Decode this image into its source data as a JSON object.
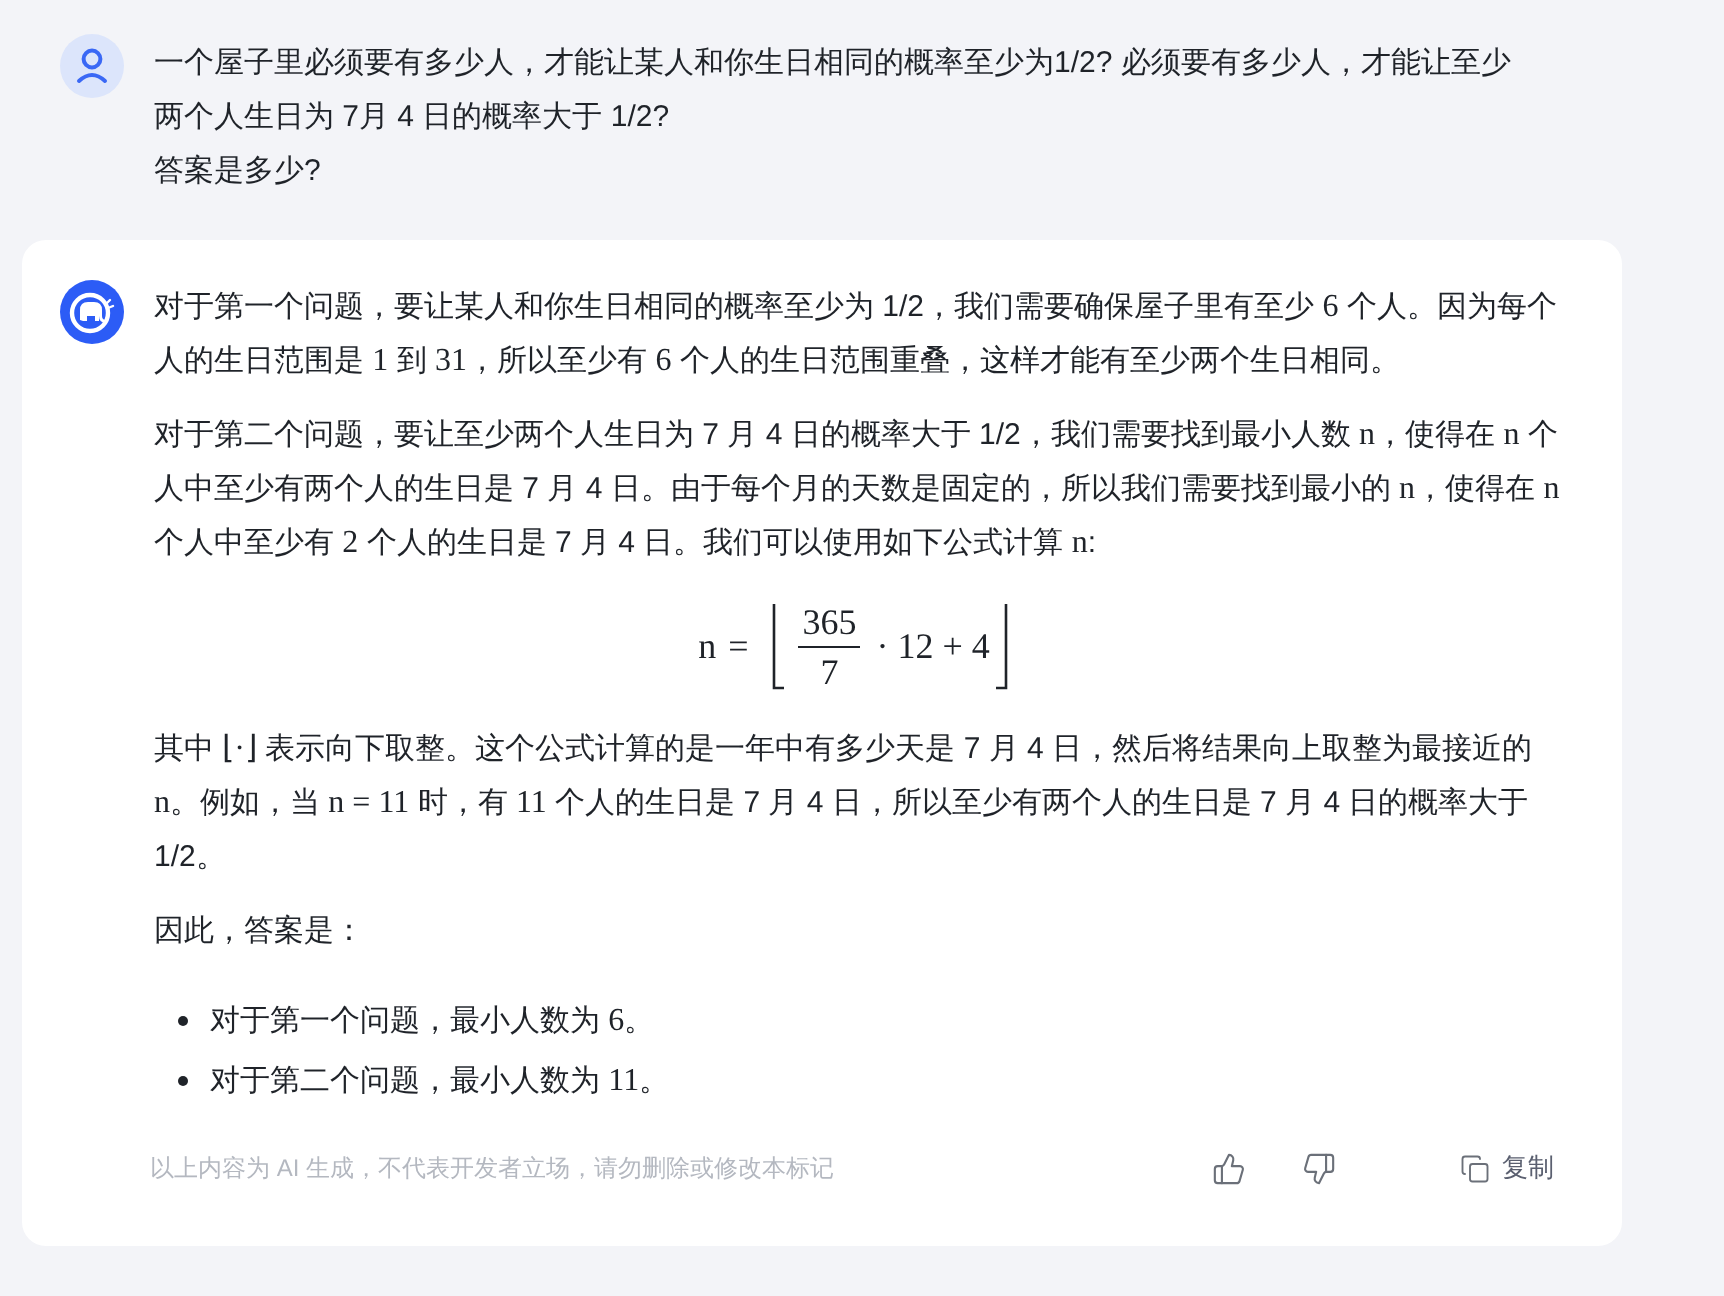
{
  "user_message": {
    "text": "一个屋子里必须要有多少人，才能让某人和你生日相同的概率至少为1/2? 必须要有多少人，才能让至少两个人生日为 7月 4 日的概率大于 1/2?\n答案是多少?"
  },
  "answer": {
    "blocks": [
      {
        "kind": "paragraph",
        "parts": [
          {
            "kind": "text",
            "text": "对于第一个问题，要让某人和你生日相同的概率至少为 1/2，我们需要确保屋子里有至少 "
          },
          {
            "kind": "math",
            "text": "6"
          },
          {
            "kind": "text",
            "text": " 个人。因为每个人的生日范围是 "
          },
          {
            "kind": "math",
            "text": "1"
          },
          {
            "kind": "text",
            "text": " 到 "
          },
          {
            "kind": "math",
            "text": "31"
          },
          {
            "kind": "text",
            "text": "，所以至少有 "
          },
          {
            "kind": "math",
            "text": "6"
          },
          {
            "kind": "text",
            "text": " 个人的生日范围重叠，这样才能有至少两个生日相同。"
          }
        ]
      },
      {
        "kind": "paragraph",
        "parts": [
          {
            "kind": "text",
            "text": "对于第二个问题，要让至少两个人生日为 7 月 4 日的概率大于 1/2，我们需要找到最小人数 "
          },
          {
            "kind": "math",
            "text": "n"
          },
          {
            "kind": "text",
            "text": "，使得在 "
          },
          {
            "kind": "math",
            "text": "n"
          },
          {
            "kind": "text",
            "text": " 个人中至少有两个人的生日是 7 月 4 日。由于每个月的天数是固定的，所以我们需要找到最小的 "
          },
          {
            "kind": "math",
            "text": "n"
          },
          {
            "kind": "text",
            "text": "，使得在 "
          },
          {
            "kind": "math",
            "text": "n"
          },
          {
            "kind": "text",
            "text": " 个人中至少有 "
          },
          {
            "kind": "math",
            "text": "2"
          },
          {
            "kind": "text",
            "text": " 个人的生日是 7 月 4 日。我们可以使用如下公式计算 "
          },
          {
            "kind": "math",
            "text": "n"
          },
          {
            "kind": "text",
            "text": ":"
          }
        ]
      },
      {
        "kind": "formula",
        "lhs": "n",
        "relation": "=",
        "numerator": "365",
        "denominator": "7",
        "after_fraction": "· 12 + 4"
      },
      {
        "kind": "paragraph",
        "parts": [
          {
            "kind": "text",
            "text": "其中 "
          },
          {
            "kind": "math",
            "text": "⌊·⌋"
          },
          {
            "kind": "text",
            "text": " 表示向下取整。这个公式计算的是一年中有多少天是 7 月 4 日，然后将结果向上取整为最接近的 "
          },
          {
            "kind": "math",
            "text": "n"
          },
          {
            "kind": "text",
            "text": "。例如，当 "
          },
          {
            "kind": "math",
            "text": "n = 11"
          },
          {
            "kind": "text",
            "text": " 时，有 "
          },
          {
            "kind": "math",
            "text": "11"
          },
          {
            "kind": "text",
            "text": " 个人的生日是 7 月 4 日，所以至少有两个人的生日是 7 月 4 日的概率大于 1/2。"
          }
        ]
      },
      {
        "kind": "paragraph",
        "parts": [
          {
            "kind": "text",
            "text": "因此，答案是："
          }
        ]
      },
      {
        "kind": "list",
        "items": [
          {
            "parts": [
              {
                "kind": "text",
                "text": "对于第一个问题，最小人数为 "
              },
              {
                "kind": "math",
                "text": "6"
              },
              {
                "kind": "text",
                "text": "。"
              }
            ]
          },
          {
            "parts": [
              {
                "kind": "text",
                "text": "对于第二个问题，最小人数为 "
              },
              {
                "kind": "math",
                "text": "11"
              },
              {
                "kind": "text",
                "text": "。"
              }
            ]
          }
        ]
      }
    ],
    "disclaimer": "以上内容为 AI 生成，不代表开发者立场，请勿删除或修改本标记",
    "actions": [
      {
        "kind": "like"
      },
      {
        "kind": "dislike"
      },
      {
        "kind": "copy",
        "label": "复制"
      }
    ]
  }
}
